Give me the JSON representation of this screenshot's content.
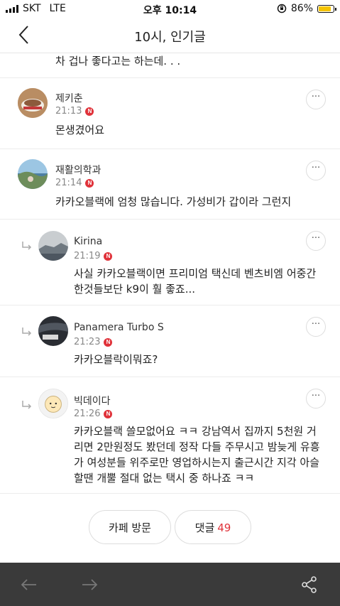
{
  "status": {
    "carrier": "SKT",
    "network": "LTE",
    "time": "오후 10:14",
    "battery": "86%",
    "battery_fill": 0.86
  },
  "nav": {
    "title": "10시, 인기글"
  },
  "previous_line": "차 겁나 좋다고는 하는데. . .",
  "comments": [
    {
      "author": "제키춘",
      "time": "21:13",
      "text": "몬생겼어요",
      "new": "N",
      "more": "···"
    },
    {
      "author": "재활의학과",
      "time": "21:14",
      "text": "카카오블랙에 엄청 많습니다. 가성비가 갑이라 그런지",
      "new": "N",
      "more": "···"
    },
    {
      "author": "Kirina",
      "time": "21:19",
      "text1": "사실 카카오블랙이면 프리미엄 택신데 벤츠비엠 어중간",
      "text2": "한것들보단 k9이 훨 좋죠...",
      "new": "N",
      "more": "···"
    },
    {
      "author": "Panamera Turbo S",
      "time": "21:23",
      "text": "카카오블락이뭐죠?",
      "new": "N",
      "more": "···"
    },
    {
      "author": "빅데이다",
      "time": "21:26",
      "text1": "카카오블랙 쓸모없어요 ㅋㅋ 강남역서 집까지 5천원 거",
      "text2": "리면 2만원정도 봤던데 정작 다들 주무시고 밤늦게 유흥",
      "text3": "가 여성분들 위주로만 영업하시는지 출근시간 지각 아슬",
      "text4": "할땐 개뿔 절대 없는 택시 중 하나죠 ㅋㅋ",
      "new": "N",
      "more": "···"
    }
  ],
  "buttons": {
    "cafe_visit": "카페 방문",
    "comments_label": "댓글",
    "comments_count": "49"
  },
  "icons": {
    "back": "chevron-left-icon",
    "prev": "arrow-left-icon",
    "next": "arrow-right-icon",
    "share": "share-icon"
  },
  "colors": {
    "badge": "#e0323a",
    "toolbar": "#3a3a3a",
    "battery": "#f5c400"
  }
}
